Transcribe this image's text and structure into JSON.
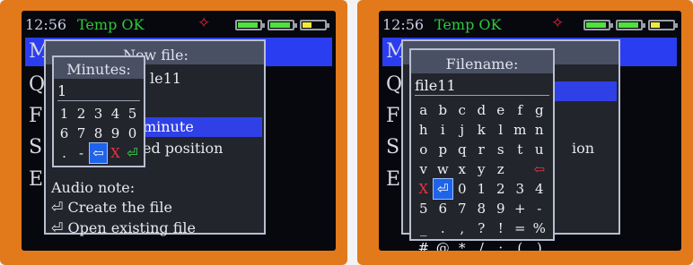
{
  "colors": {
    "accent": "#2f40e6",
    "temp_ok": "#2ec93c",
    "bluetooth": "#e4253b",
    "delete": "#f0333f",
    "enter": "#40e052"
  },
  "status": {
    "time": "12:56",
    "temp": "Temp OK",
    "bluetooth_icon": "✧"
  },
  "left": {
    "menu_letters": [
      "M",
      "Q",
      "F",
      "S",
      "E"
    ],
    "newfile": {
      "title": "New file:",
      "name_partial": "le11",
      "row_minute": "minute",
      "row_position": "ed position",
      "audio_note": "Audio note:",
      "create": "⏎ Create the file",
      "open": "⏎ Open existing file"
    },
    "minutes": {
      "title": "Minutes:",
      "value": "1",
      "keys": [
        "1",
        "2",
        "3",
        "4",
        "5",
        "6",
        "7",
        "8",
        "9",
        "0",
        ".",
        "-",
        "⇦",
        "X",
        "⏎"
      ]
    }
  },
  "right": {
    "menu_letters": [
      "M",
      "Q",
      "F",
      "S",
      "E"
    ],
    "behind_text": "ion",
    "filename": {
      "title": "Filename:",
      "value": "file11",
      "keys": [
        "a",
        "b",
        "c",
        "d",
        "e",
        "f",
        "g",
        "h",
        "i",
        "j",
        "k",
        "l",
        "m",
        "n",
        "o",
        "p",
        "q",
        "r",
        "s",
        "t",
        "u",
        "v",
        "w",
        "x",
        "y",
        "z",
        " ",
        "⇦",
        "X",
        "⏎",
        "0",
        "1",
        "2",
        "3",
        "4",
        "5",
        "6",
        "7",
        "8",
        "9",
        "+",
        "-",
        "_",
        ".",
        ",",
        "?",
        "!",
        "=",
        "%",
        "#",
        "@",
        "*",
        "/",
        ":",
        "(",
        ")"
      ]
    }
  }
}
